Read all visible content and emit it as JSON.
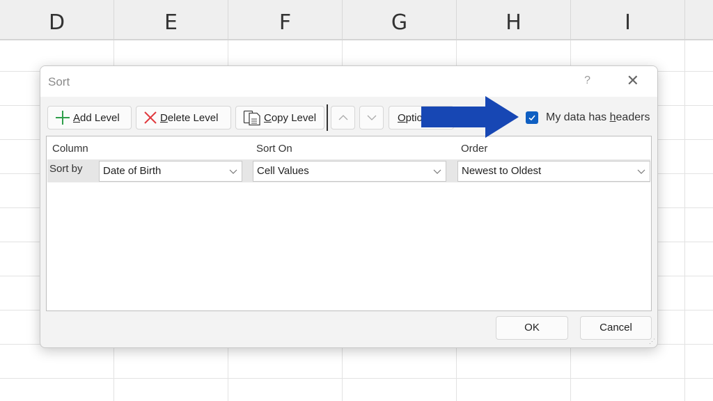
{
  "spreadsheet": {
    "columns": [
      "D",
      "E",
      "F",
      "G",
      "H",
      "I"
    ]
  },
  "dialog": {
    "title": "Sort",
    "help_label": "?",
    "close_label": "✕",
    "toolbar": {
      "add_level": {
        "accel": "A",
        "rest": "dd Level"
      },
      "delete_level": {
        "accel": "D",
        "rest": "elete Level"
      },
      "copy_level": {
        "accel": "C",
        "rest": "opy Level"
      },
      "move_up": "︿",
      "move_down": "﹀",
      "options": {
        "accel": "O",
        "rest": "ptions..."
      }
    },
    "headers_checkbox": {
      "checked": true,
      "label_pre": "My data has ",
      "accel": "h",
      "label_post": "eaders"
    },
    "table": {
      "headers": {
        "column": "Column",
        "sort_on": "Sort On",
        "order": "Order"
      },
      "rows": [
        {
          "label": "Sort by",
          "column": "Date of Birth",
          "sort_on": "Cell Values",
          "order": "Newest to Oldest"
        }
      ]
    },
    "ok_label": "OK",
    "cancel_label": "Cancel"
  },
  "annotation": {
    "arrow_color": "#1747b4"
  }
}
